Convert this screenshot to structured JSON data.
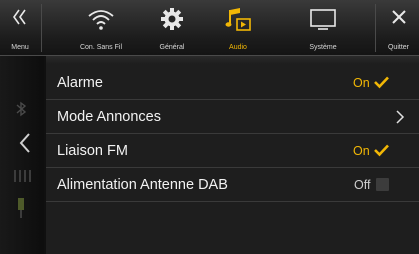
{
  "toolbar": {
    "menu_label": "Menu",
    "wifi_label": "Con. Sans Fil",
    "general_label": "Général",
    "audio_label": "Audio",
    "system_label": "Système",
    "quit_label": "Quitter"
  },
  "settings": {
    "rows": [
      {
        "label": "Alarme",
        "state": "On",
        "control": "checkbox-checked"
      },
      {
        "label": "Mode Annonces",
        "control": "chevron"
      },
      {
        "label": "Liaison FM",
        "state": "On",
        "control": "checkbox-checked"
      },
      {
        "label": "Alimentation Antenne DAB",
        "state": "Off",
        "control": "checkbox-empty"
      }
    ]
  },
  "colors": {
    "accent": "#f2b705",
    "background": "#1e1e1e",
    "toolbar": "#2a2a2a"
  }
}
